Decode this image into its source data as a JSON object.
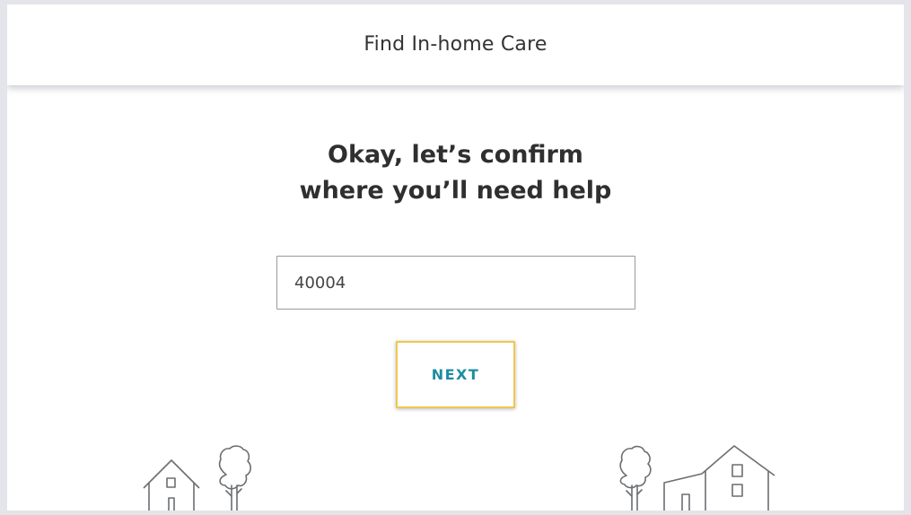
{
  "header": {
    "title": "Find In-home Care"
  },
  "main": {
    "headline_line1": "Okay, let’s confirm",
    "headline_line2": "where you’ll need help",
    "zip_input": {
      "value": "40004",
      "placeholder": ""
    },
    "next_label": "NEXT"
  },
  "colors": {
    "accent_text": "#1e8ca0",
    "button_border": "#f1c550",
    "line_art": "#6b6e72"
  },
  "illustrations": {
    "left": [
      "house-icon",
      "tree-icon"
    ],
    "right": [
      "tree-icon",
      "house-icon"
    ]
  }
}
